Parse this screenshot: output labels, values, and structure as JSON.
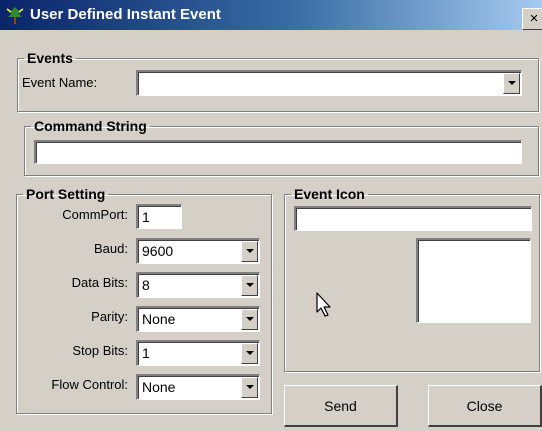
{
  "window": {
    "title": "User Defined Instant Event",
    "close_glyph": "×"
  },
  "events": {
    "legend": "Events",
    "event_name_label": "Event Name:",
    "event_name_value": ""
  },
  "command": {
    "legend": "Command String",
    "value": ""
  },
  "port": {
    "legend": "Port Setting",
    "commport_label": "CommPort:",
    "commport_value": "1",
    "baud_label": "Baud:",
    "baud_value": "9600",
    "databits_label": "Data Bits:",
    "databits_value": "8",
    "parity_label": "Parity:",
    "parity_value": "None",
    "stopbits_label": "Stop Bits:",
    "stopbits_value": "1",
    "flow_label": "Flow Control:",
    "flow_value": "None"
  },
  "event_icon": {
    "legend": "Event Icon",
    "path_value": ""
  },
  "buttons": {
    "send": "Send",
    "close": "Close"
  },
  "icons": {
    "app": "tree-icon",
    "dropdown": "chevron-down-icon",
    "cursor": "mouse-pointer-icon"
  },
  "colors": {
    "face": "#d4d0c8",
    "title_start": "#0a246a",
    "title_end": "#a6caf0"
  }
}
